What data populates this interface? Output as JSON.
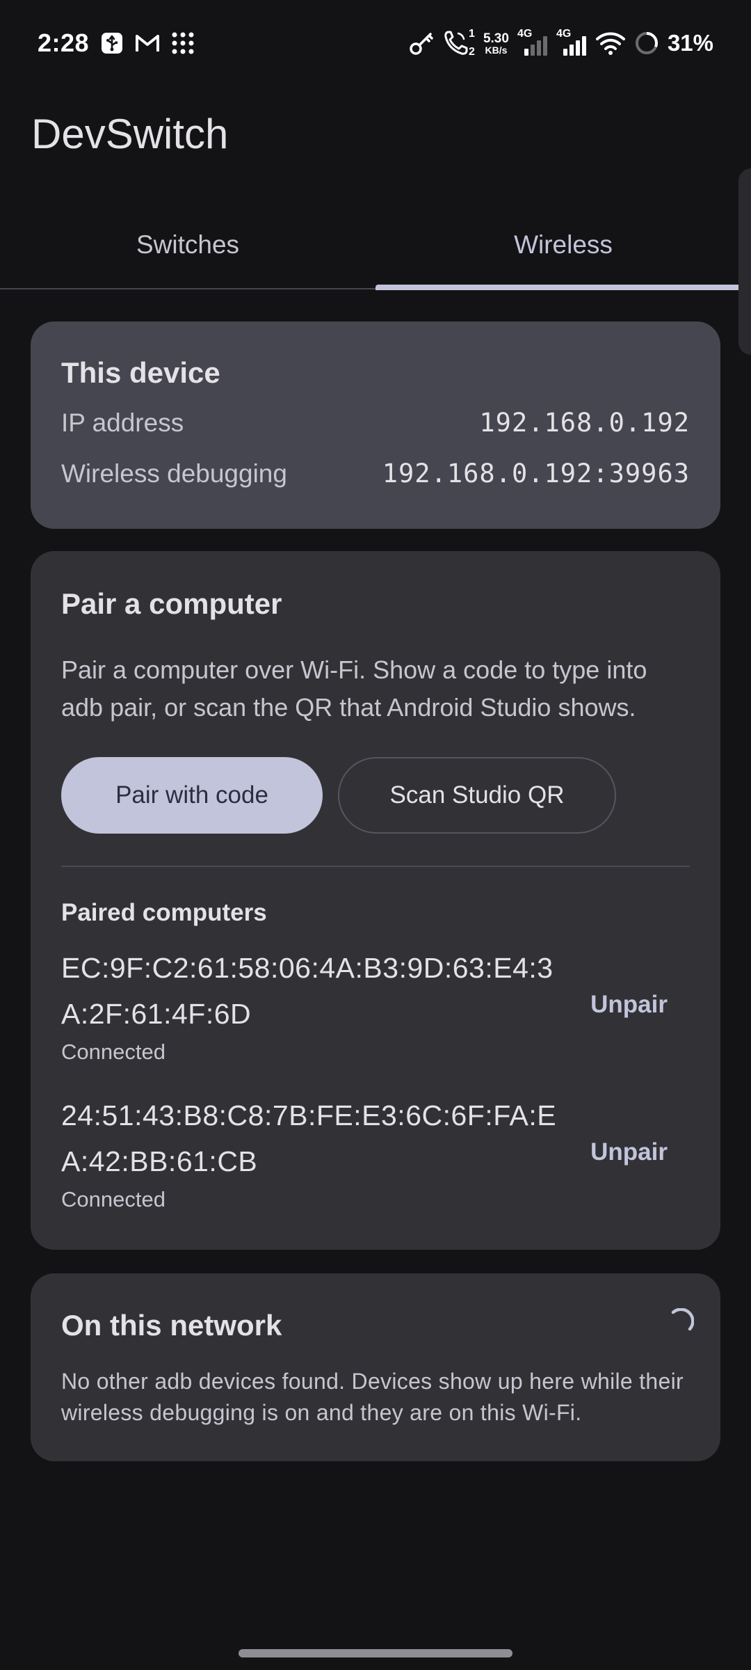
{
  "status_bar": {
    "time": "2:28",
    "left_icons": [
      "usb-icon",
      "gmail-icon",
      "apps-grid-icon"
    ],
    "call_sim_top": "1",
    "call_sim_bottom": "2",
    "net_speed_value": "5.30",
    "net_speed_unit": "KB/s",
    "net_type_1": "4G",
    "net_type_2": "4G",
    "battery": "31%"
  },
  "app": {
    "title": "DevSwitch"
  },
  "tabs": [
    {
      "label": "Switches",
      "active": false
    },
    {
      "label": "Wireless",
      "active": true
    }
  ],
  "device_card": {
    "title": "This device",
    "rows": [
      {
        "label": "IP address",
        "value": "192.168.0.192"
      },
      {
        "label": "Wireless debugging",
        "value": "192.168.0.192:39963"
      }
    ]
  },
  "pair_card": {
    "title": "Pair a computer",
    "description": "Pair a computer over Wi-Fi. Show a code to type into adb pair, or scan the QR that Android Studio shows.",
    "primary_button": "Pair with code",
    "secondary_button": "Scan Studio QR",
    "paired_title": "Paired computers",
    "paired": [
      {
        "mac": "EC:9F:C2:61:58:06:4A:B3:9D:63:E4:3A:2F:61:4F:6D",
        "status": "Connected",
        "action": "Unpair"
      },
      {
        "mac": "24:51:43:B8:C8:7B:FE:E3:6C:6F:FA:EA:42:BB:61:CB",
        "status": "Connected",
        "action": "Unpair"
      }
    ]
  },
  "network_card": {
    "title": "On this network",
    "description": "No other adb devices found. Devices show up here while their wireless debugging is on and they are on this Wi-Fi."
  },
  "colors": {
    "background": "#131315",
    "accent": "#c2c4dc",
    "device_card": "#45464f",
    "card": "#323236"
  }
}
